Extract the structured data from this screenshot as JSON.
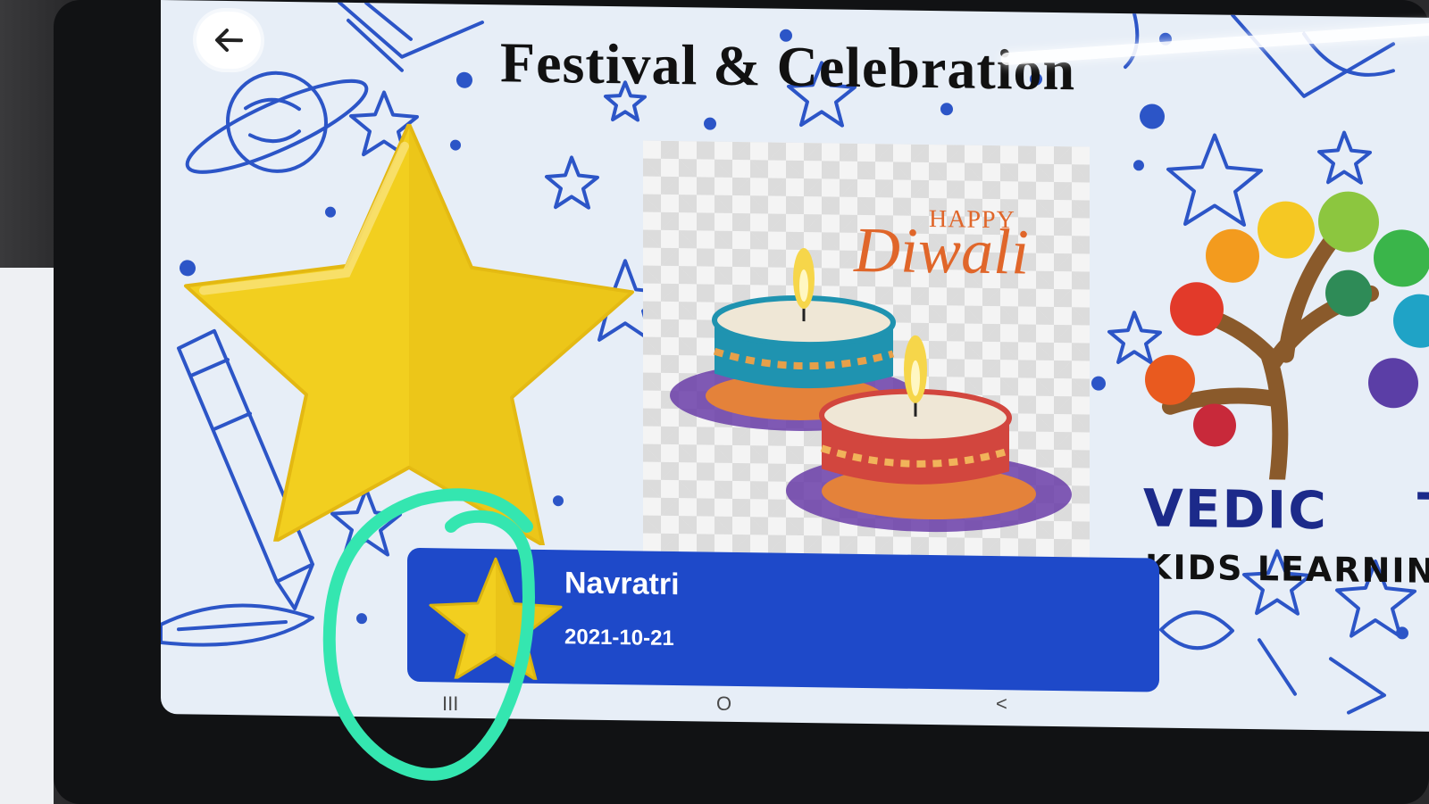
{
  "header": {
    "back_icon": "arrow-left-icon",
    "title": "Festival & Celebration"
  },
  "diwali_card": {
    "happy": "HAPPY",
    "word": "Diwali"
  },
  "logo": {
    "line1": "VEDIC",
    "line1_suffix": "T",
    "line2": "KIDS LEARNIN"
  },
  "festival_list": [
    {
      "icon": "star-icon",
      "name": "Navratri",
      "date": "2021-10-21"
    }
  ],
  "navbar": {
    "recents_glyph": "III",
    "home_glyph": "O",
    "back_glyph": "<"
  },
  "colors": {
    "list_item_bg": "#1e49c9",
    "star": "#f2cf1f",
    "annotation_circle": "#34e6b0",
    "title_text": "#111111"
  }
}
